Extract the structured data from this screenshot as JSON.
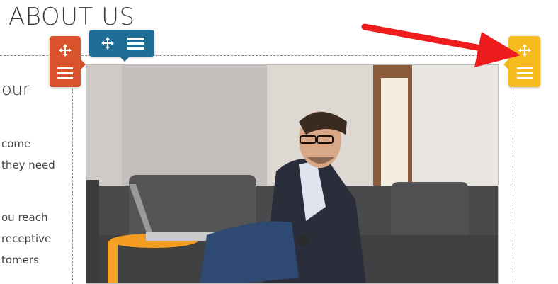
{
  "page": {
    "heading": "ABOUT US"
  },
  "column": {
    "title": "our",
    "lines": [
      "come",
      "they need",
      "ou reach",
      "receptive",
      "tomers"
    ]
  },
  "controls": {
    "orange": {
      "color": "#d9532c",
      "icons": [
        "move-icon",
        "menu-icon"
      ]
    },
    "blue": {
      "color": "#1f6e97",
      "icons": [
        "move-icon",
        "menu-icon"
      ]
    },
    "yellow": {
      "color": "#f6bb1f",
      "icons": [
        "move-icon",
        "menu-icon"
      ]
    }
  },
  "annotation": {
    "arrow_color": "#ee1c1c"
  }
}
